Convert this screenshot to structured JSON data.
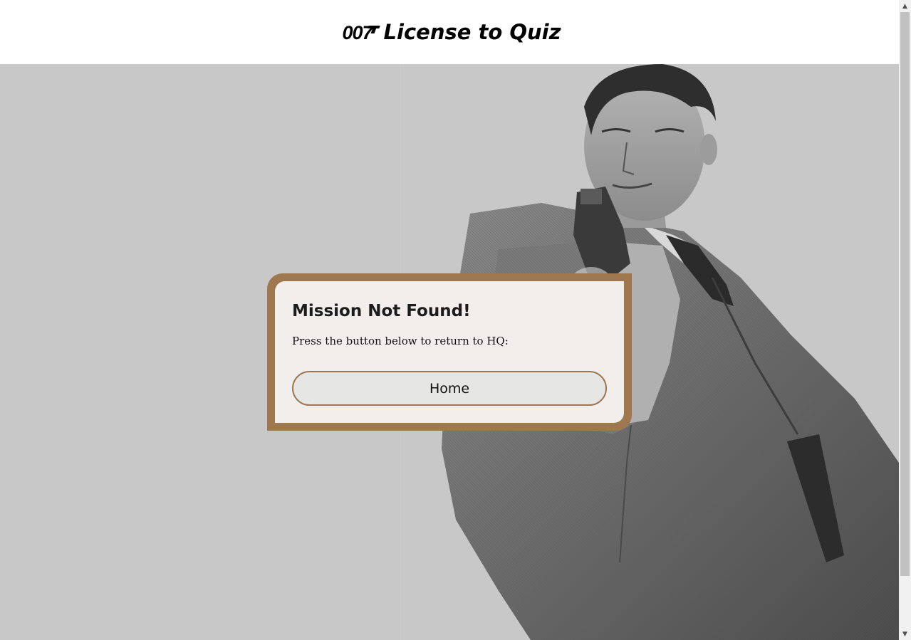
{
  "header": {
    "logo_text": "007",
    "title": "License to Quiz"
  },
  "hero": {
    "image": "black-and-white-agent-aiming-pistol"
  },
  "dialog": {
    "title": "Mission Not Found!",
    "message": "Press the button below to return to HQ:",
    "home_button_label": "Home"
  },
  "colors": {
    "accent": "#a07850",
    "hero_background": "#c8c8c8",
    "header_background": "#ffffff"
  }
}
